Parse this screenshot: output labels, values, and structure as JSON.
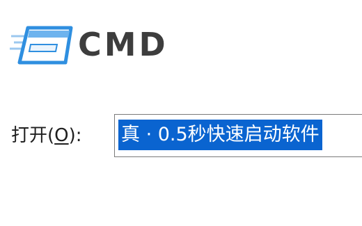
{
  "dialog": {
    "title": "CMD",
    "icon": "run-dialog-icon"
  },
  "open_field": {
    "label_prefix": "打开(",
    "label_mnemonic": "O",
    "label_suffix": "):",
    "value": "真 · 0.5秒快速启动软件",
    "selected": true
  },
  "colors": {
    "selection_bg": "#0a64d0",
    "selection_text": "#ffffff",
    "title_text": "#3d3d3d",
    "icon_blue": "#2f8fe0"
  }
}
